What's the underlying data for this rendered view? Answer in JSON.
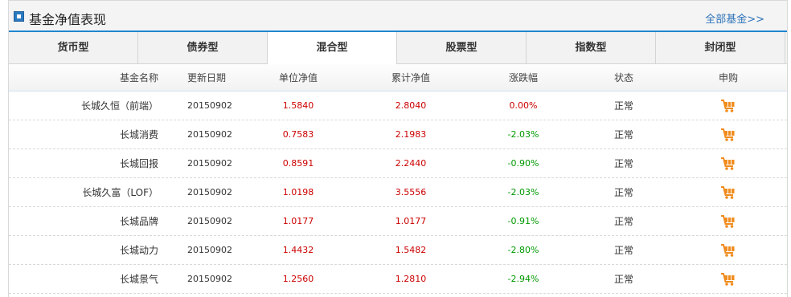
{
  "header": {
    "title": "基金净值表现",
    "more_link": "全部基金>>"
  },
  "tabs": [
    {
      "label": "货币型"
    },
    {
      "label": "债券型"
    },
    {
      "label": "混合型"
    },
    {
      "label": "股票型"
    },
    {
      "label": "指数型"
    },
    {
      "label": "封闭型"
    }
  ],
  "active_tab": 2,
  "table": {
    "columns": [
      "基金名称",
      "更新日期",
      "单位净值",
      "累计净值",
      "涨跌幅",
      "状态",
      "申购"
    ],
    "rows": [
      {
        "name": "长城久恒（前端）",
        "date": "20150902",
        "unit_nav": "1.5840",
        "acc_nav": "2.8040",
        "change": "0.00%",
        "status": "正常",
        "buy_icon": "shopping-cart-icon"
      },
      {
        "name": "长城消费",
        "date": "20150902",
        "unit_nav": "0.7583",
        "acc_nav": "2.1983",
        "change": "-2.03%",
        "status": "正常",
        "buy_icon": "shopping-cart-icon"
      },
      {
        "name": "长城回报",
        "date": "20150902",
        "unit_nav": "0.8591",
        "acc_nav": "2.2440",
        "change": "-0.90%",
        "status": "正常",
        "buy_icon": "shopping-cart-icon"
      },
      {
        "name": "长城久富（LOF）",
        "date": "20150902",
        "unit_nav": "1.0198",
        "acc_nav": "3.5556",
        "change": "-2.03%",
        "status": "正常",
        "buy_icon": "shopping-cart-icon"
      },
      {
        "name": "长城品牌",
        "date": "20150902",
        "unit_nav": "1.0177",
        "acc_nav": "1.0177",
        "change": "-0.91%",
        "status": "正常",
        "buy_icon": "shopping-cart-icon"
      },
      {
        "name": "长城动力",
        "date": "20150902",
        "unit_nav": "1.4432",
        "acc_nav": "1.5482",
        "change": "-2.80%",
        "status": "正常",
        "buy_icon": "shopping-cart-icon"
      },
      {
        "name": "长城景气",
        "date": "20150902",
        "unit_nav": "1.2560",
        "acc_nav": "1.2810",
        "change": "-2.94%",
        "status": "正常",
        "buy_icon": "shopping-cart-icon"
      }
    ]
  },
  "colors": {
    "accent_blue": "#1f85cf",
    "link_blue": "#2e73b8",
    "value_red": "#cc0000",
    "change_green": "#009900",
    "cart_orange": "#f08c1e"
  }
}
